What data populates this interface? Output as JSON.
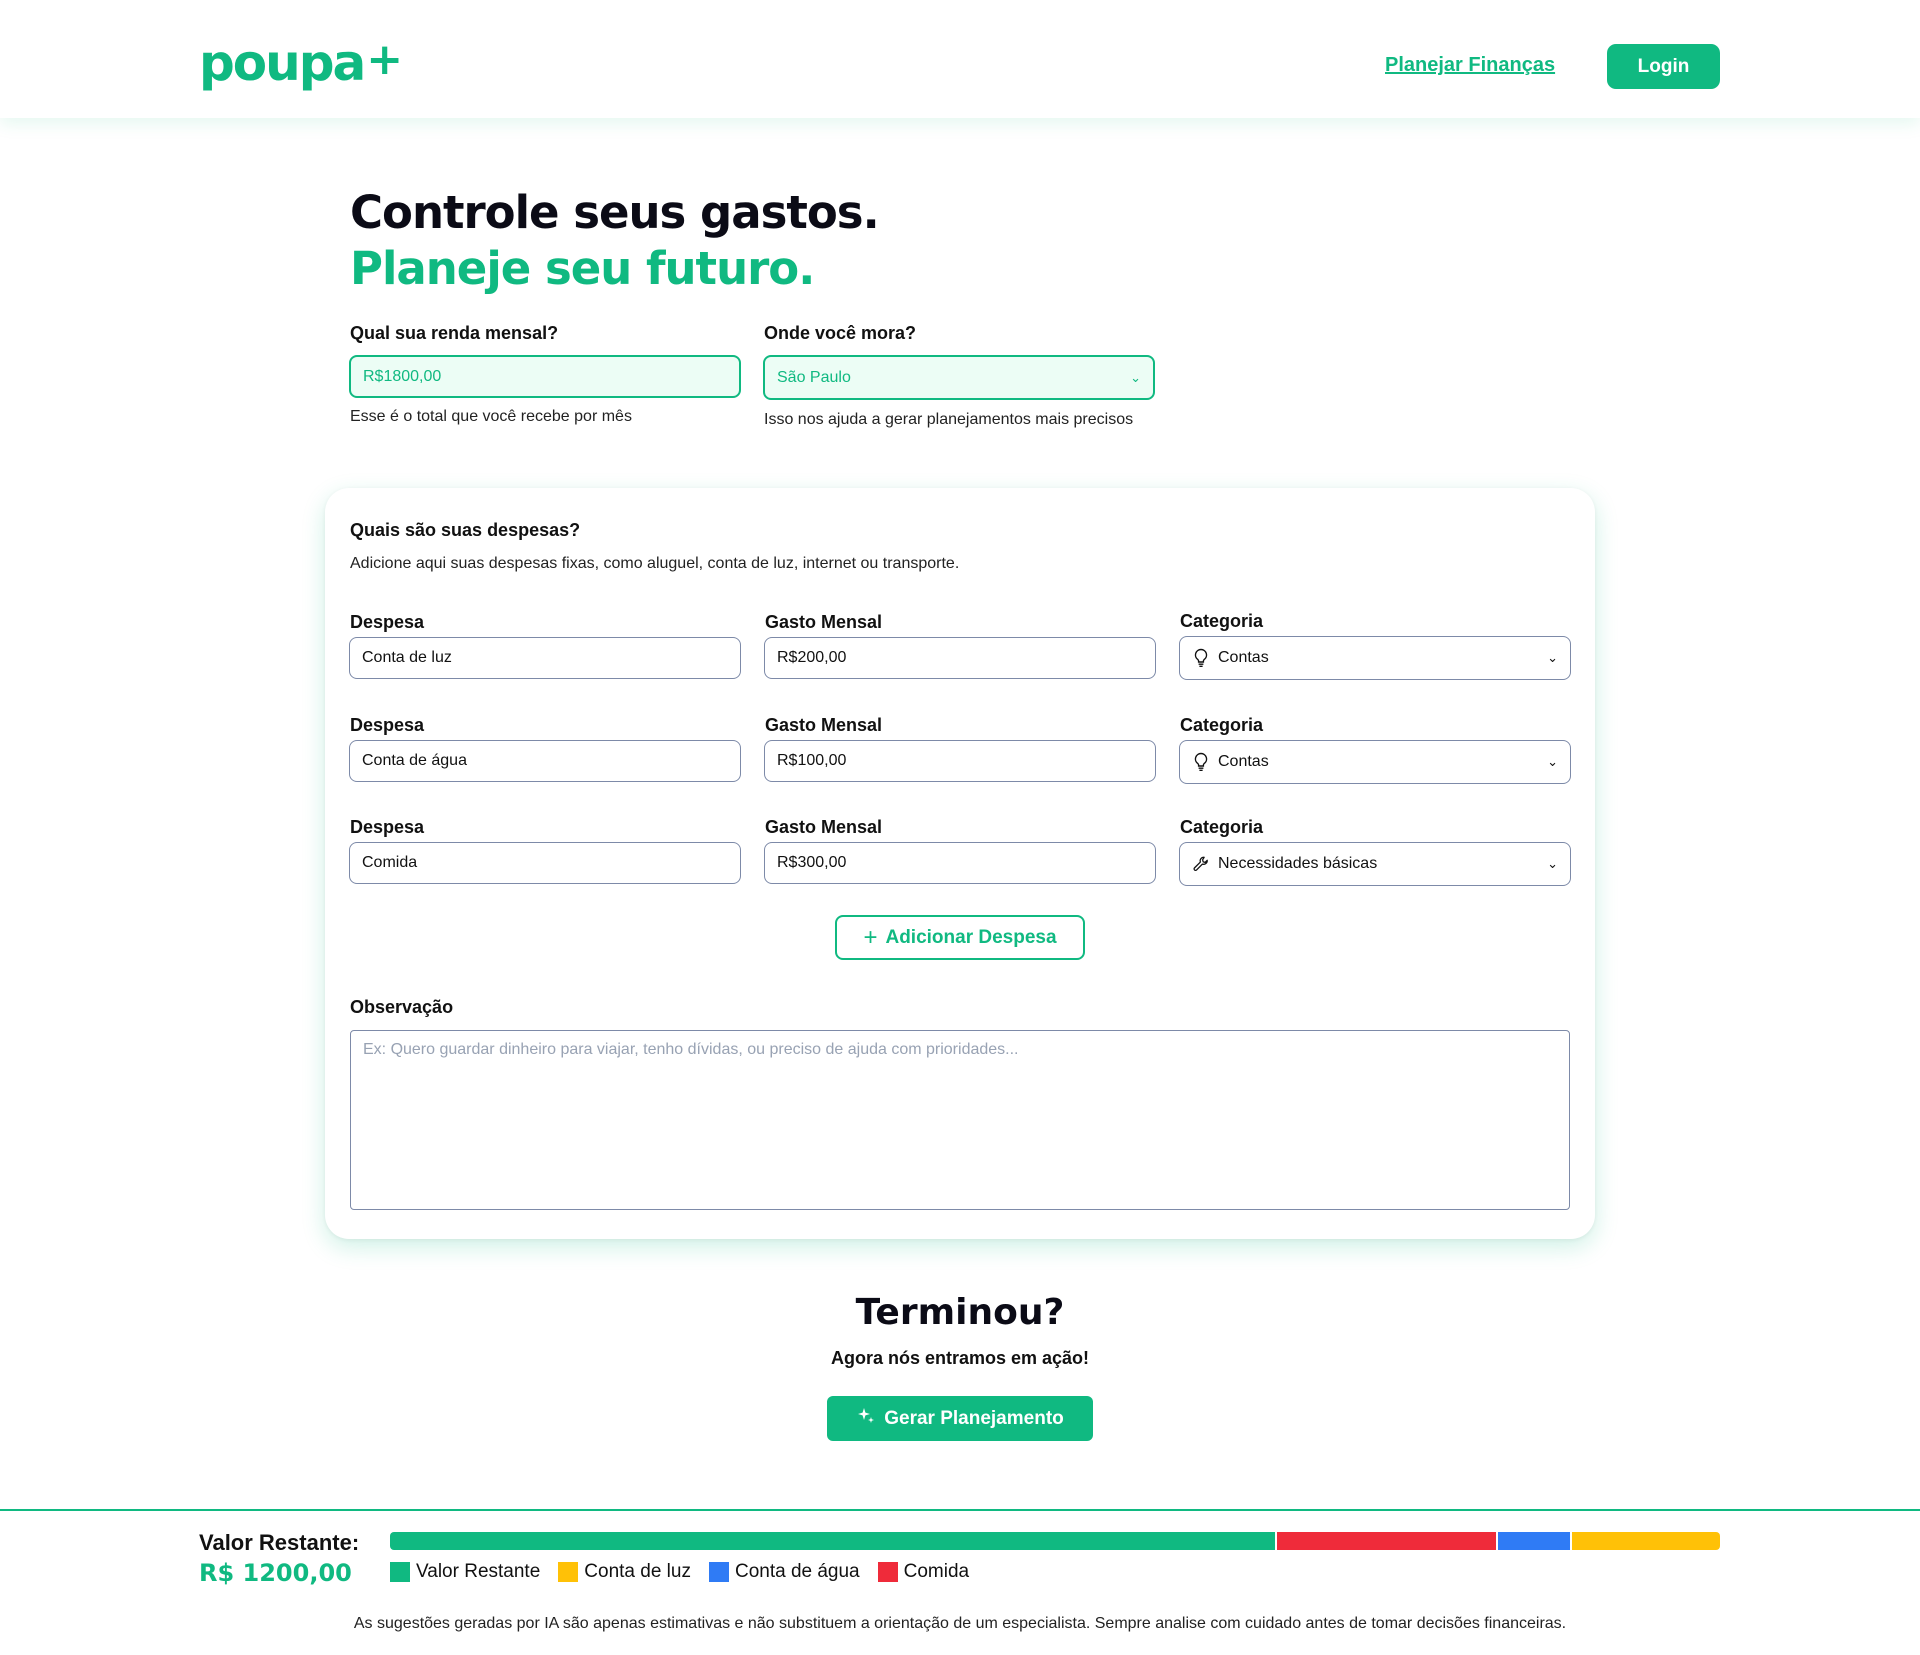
{
  "brand": {
    "logo": "poupa",
    "logo_plus": "+",
    "accent": "#10b981"
  },
  "nav": {
    "plan_link": "Planejar Finanças",
    "login": "Login"
  },
  "hero": {
    "line1": "Controle seus gastos.",
    "line2": "Planeje seu futuro."
  },
  "income": {
    "label": "Qual sua renda mensal?",
    "value": "R$1800,00",
    "hint": "Esse é o total que você recebe por mês"
  },
  "location": {
    "label": "Onde você mora?",
    "value": "São Paulo",
    "hint": "Isso nos ajuda a  gerar planejamentos mais precisos"
  },
  "expenses": {
    "title": "Quais são suas despesas?",
    "subtitle": "Adicione aqui suas despesas fixas, como aluguel, conta de luz, internet ou transporte.",
    "col_expense": "Despesa",
    "col_amount": "Gasto Mensal",
    "col_category": "Categoria",
    "rows": [
      {
        "expense": "Conta de luz",
        "amount": "R$200,00",
        "category": "Contas",
        "icon": "lightbulb-icon"
      },
      {
        "expense": "Conta de água",
        "amount": "R$100,00",
        "category": "Contas",
        "icon": "lightbulb-icon"
      },
      {
        "expense": "Comida",
        "amount": "R$300,00",
        "category": "Necessidades básicas",
        "icon": "tool-icon"
      }
    ],
    "add_button": "Adicionar Despesa",
    "notes_label": "Observação",
    "notes_placeholder": "Ex: Quero guardar dinheiro para viajar, tenho dívidas, ou preciso de ajuda com prioridades..."
  },
  "finish": {
    "title": "Terminou?",
    "subtitle": "Agora nós entramos em ação!",
    "button": "Gerar Planejamento"
  },
  "summary": {
    "label": "Valor Restante:",
    "value": "R$ 1200,00",
    "bar": [
      {
        "name": "Valor Restante",
        "amount": 1200,
        "color": "#10b981"
      },
      {
        "name": "Comida",
        "amount": 300,
        "color": "#ef2b3a"
      },
      {
        "name": "Conta de água",
        "amount": 100,
        "color": "#2f7bf5"
      },
      {
        "name": "Conta de luz",
        "amount": 200,
        "color": "#ffc107"
      }
    ],
    "legend": [
      {
        "name": "Valor Restante",
        "color": "#10b981"
      },
      {
        "name": "Conta de luz",
        "color": "#ffc107"
      },
      {
        "name": "Conta de água",
        "color": "#2f7bf5"
      },
      {
        "name": "Comida",
        "color": "#ef2b3a"
      }
    ]
  },
  "disclaimer": "As sugestões geradas por IA são apenas estimativas e não substituem a orientação de um especialista. Sempre analise com cuidado antes de tomar decisões financeiras."
}
